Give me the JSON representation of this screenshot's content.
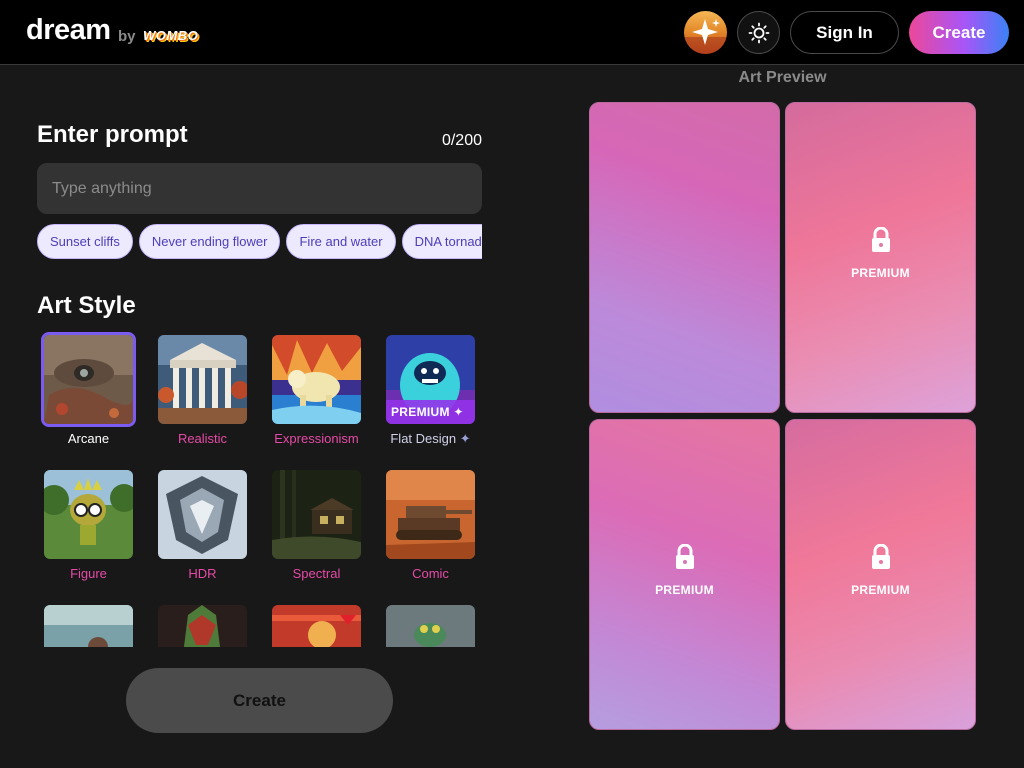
{
  "header": {
    "logo_text": "dream",
    "by_text": "by",
    "brand_text": "WOMBO",
    "avatar_icon": "sparkle-avatar-icon",
    "theme_icon": "sun-icon",
    "signin_label": "Sign In",
    "create_label": "Create"
  },
  "prompt": {
    "title": "Enter prompt",
    "counter": "0/200",
    "value": "",
    "placeholder": "Type anything",
    "suggestions": [
      "Sunset cliffs",
      "Never ending flower",
      "Fire and water",
      "DNA tornado"
    ]
  },
  "art_style": {
    "title": "Art Style",
    "selected": "Arcane",
    "styles": [
      {
        "name": "Arcane",
        "premium": false
      },
      {
        "name": "Realistic",
        "premium": false
      },
      {
        "name": "Expressionism",
        "premium": false
      },
      {
        "name": "Flat Design",
        "premium": true,
        "badge": "PREMIUM",
        "label_icon": "sparkle-icon"
      },
      {
        "name": "Figure",
        "premium": false
      },
      {
        "name": "HDR",
        "premium": false
      },
      {
        "name": "Spectral",
        "premium": false
      },
      {
        "name": "Comic",
        "premium": false
      }
    ]
  },
  "create_button_label": "Create",
  "preview": {
    "title": "Art Preview",
    "cards": [
      {
        "locked": false,
        "label": ""
      },
      {
        "locked": true,
        "label": "PREMIUM",
        "icon": "lock-icon"
      },
      {
        "locked": true,
        "label": "PREMIUM",
        "icon": "lock-icon"
      },
      {
        "locked": true,
        "label": "PREMIUM",
        "icon": "lock-icon"
      }
    ]
  },
  "colors": {
    "accent_gradient": [
      "#ec4899",
      "#a855f7",
      "#3b82f6"
    ],
    "style_label": "#e64aa6",
    "selected_border": "#7c5cf0",
    "chip_bg": "#ede9fe",
    "chip_text": "#4c3fb5"
  }
}
